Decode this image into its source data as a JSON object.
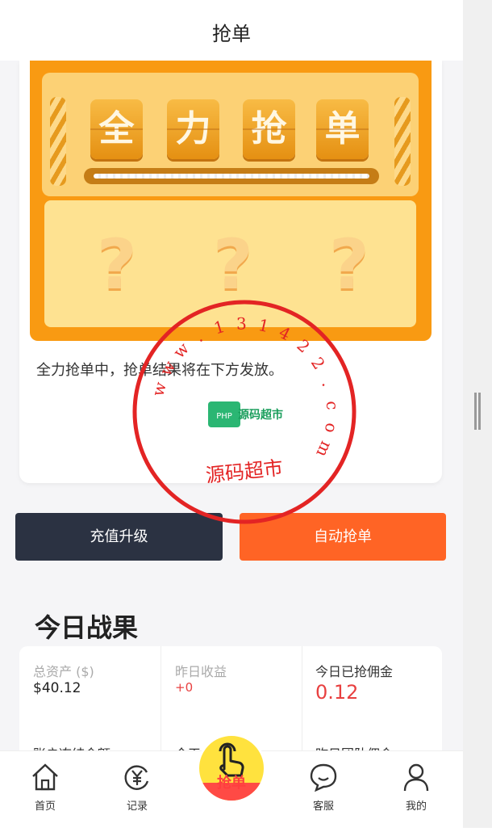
{
  "header": {
    "title": "抢单"
  },
  "banner": {
    "tiles": [
      "全",
      "力",
      "抢",
      "单"
    ],
    "mystery": [
      "?",
      "?",
      "?"
    ]
  },
  "status_message": "全力抢单中，抢单结果将在下方发放。",
  "buttons": {
    "upgrade": "充值升级",
    "auto_grab": "自动抢单"
  },
  "today": {
    "title": "今日战果",
    "stats": [
      {
        "label": "总资产 ($)",
        "value": "$40.12"
      },
      {
        "label": "昨日收益",
        "value": "+0"
      },
      {
        "label": "今日已抢佣金",
        "value": "0.12"
      }
    ],
    "stats_row2": [
      "账户冻结金额",
      "今天",
      "昨日团队佣金"
    ]
  },
  "watermark": {
    "text": "www.131422.com",
    "name": "源码超市",
    "logo": "源码超市",
    "logo_tag": "PHP"
  },
  "nav": {
    "home": "首页",
    "records": "记录",
    "grab": "抢单",
    "service": "客服",
    "mine": "我的"
  },
  "colors": {
    "primary_orange": "#ff6425",
    "dark_button": "#2b3242",
    "accent_red": "#e84040",
    "banner_orange": "#f99a12"
  }
}
